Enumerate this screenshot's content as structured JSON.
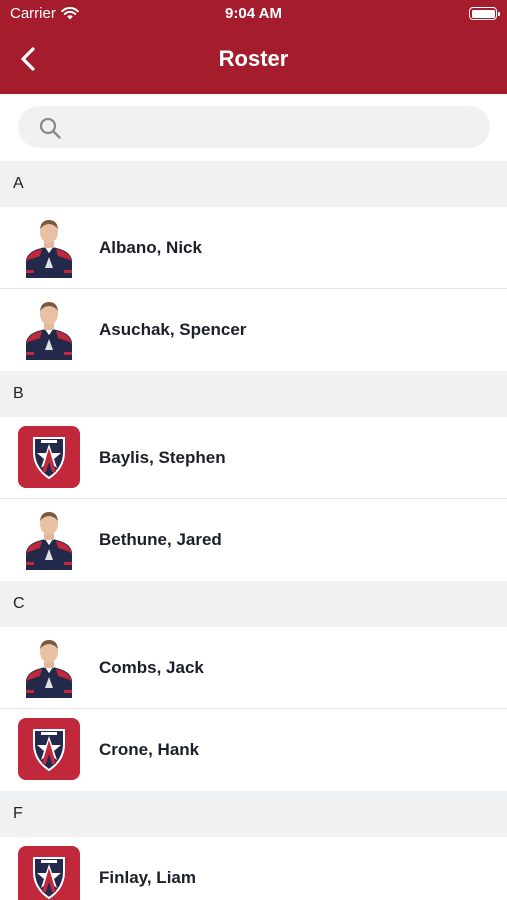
{
  "status_bar": {
    "carrier": "Carrier",
    "time": "9:04 AM"
  },
  "nav": {
    "title": "Roster",
    "back_icon": "chevron-left-icon"
  },
  "search": {
    "placeholder": "",
    "value": "",
    "icon": "search-icon"
  },
  "colors": {
    "header": "#a51c2d",
    "section_bg": "#f0f1f3",
    "jersey_navy": "#22294a",
    "jersey_red": "#c2283b"
  },
  "sections": [
    {
      "letter": "A",
      "players": [
        {
          "name": "Albano, Nick",
          "avatar": "photo"
        },
        {
          "name": "Asuchak, Spencer",
          "avatar": "photo"
        }
      ]
    },
    {
      "letter": "B",
      "players": [
        {
          "name": "Baylis, Stephen",
          "avatar": "logo"
        },
        {
          "name": "Bethune, Jared",
          "avatar": "photo"
        }
      ]
    },
    {
      "letter": "C",
      "players": [
        {
          "name": "Combs, Jack",
          "avatar": "photo"
        },
        {
          "name": "Crone, Hank",
          "avatar": "logo"
        }
      ]
    },
    {
      "letter": "F",
      "players": [
        {
          "name": "Finlay, Liam",
          "avatar": "logo"
        }
      ]
    }
  ]
}
